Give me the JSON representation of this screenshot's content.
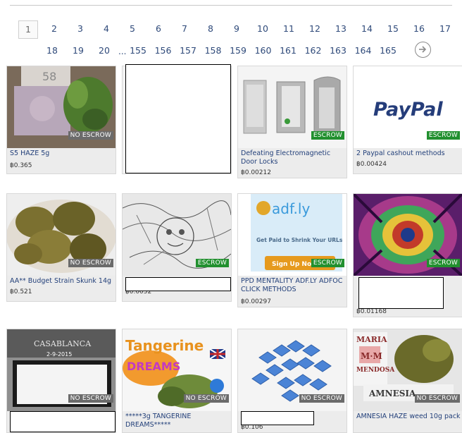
{
  "pagination": {
    "row1": [
      "1",
      "2",
      "3",
      "4",
      "5",
      "6",
      "7",
      "8",
      "9",
      "10",
      "11",
      "12",
      "13",
      "14",
      "15",
      "16",
      "17"
    ],
    "row2": [
      "18",
      "19",
      "20"
    ],
    "ellipsis": "...",
    "row2b": [
      "155",
      "156",
      "157",
      "158",
      "159",
      "160",
      "161",
      "162",
      "163",
      "164",
      "165"
    ],
    "current": "1"
  },
  "badges": {
    "no_escrow": "NO ESCROW",
    "escrow": "ESCROW"
  },
  "listings": [
    {
      "title": "S5 HAZE 5g",
      "price": "฿0.365",
      "escrow": false,
      "thumb_text": "58"
    },
    {
      "title": "",
      "price": "",
      "escrow": null
    },
    {
      "title": "Defeating Electromagnetic Door Locks",
      "price": "฿0.00212",
      "escrow": true
    },
    {
      "title": "2 Paypal cashout methods",
      "price": "฿0.00424",
      "escrow": true,
      "thumb_text": "PayPal"
    },
    {
      "title": "AA** Budget Strain Skunk 14g",
      "price": "฿0.521",
      "escrow": false
    },
    {
      "title": "",
      "price": "฿0.0052",
      "escrow": true
    },
    {
      "title": "PPD MENTALITY ADF.LY ADFOC CLICK METHODS",
      "price": "฿0.00297",
      "escrow": true,
      "thumb_text": "adf.ly",
      "thumb_sub": "Get Paid to Shrink Your URLs",
      "thumb_btn": "Sign Up Now"
    },
    {
      "title": "",
      "price": "฿0.01168",
      "escrow": true
    },
    {
      "title": "",
      "price": "",
      "escrow": false,
      "thumb_text": "CASABLANCA",
      "thumb_sub": "2-9-2015"
    },
    {
      "title": "*****3g TANGERINE DREAMS*****",
      "price": "",
      "escrow": false,
      "thumb_text": "Tangerine",
      "thumb_sub": "DREAMS"
    },
    {
      "title": "",
      "price": "฿0.106",
      "escrow": false
    },
    {
      "title": "AMNESIA HAZE weed 10g pack",
      "price": "",
      "escrow": false,
      "thumb_text": "MARIA",
      "thumb_sub": "MENDOSA",
      "thumb_label": "AMNESIA"
    }
  ],
  "colors": {
    "link": "#23407a",
    "escrow": "#22902f",
    "no_escrow": "#6b6b6b"
  }
}
